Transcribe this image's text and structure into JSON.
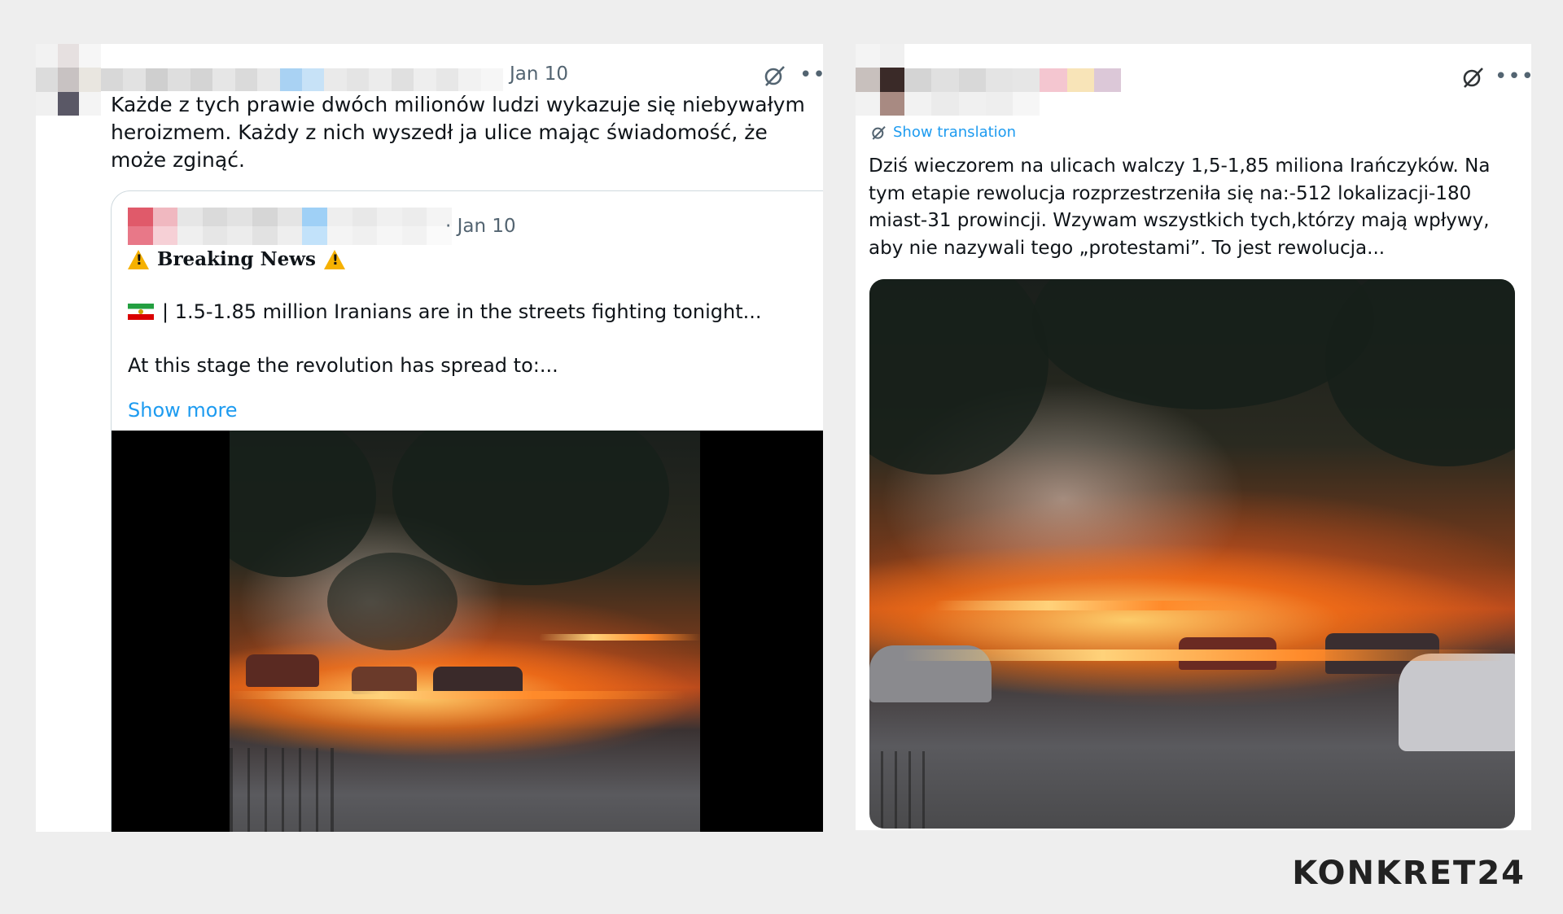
{
  "posts": [
    {
      "date": "Jan 10",
      "text": "Każde z tych prawie dwóch milionów ludzi wykazuje się niebywałym heroizmem. Każdy z nich wyszedł ja ulice mając świadomość, że może zginąć.",
      "quote": {
        "date": "· Jan 10",
        "headline": "Breaking News",
        "line1": "| 1.5-1.85 million Iranians are in the streets fighting tonight...",
        "line2": "At this stage the revolution has spread to:...",
        "show_more": "Show more"
      }
    },
    {
      "show_translation": "Show translation",
      "text": "Dziś wieczorem na ulicach walczy 1,5-1,85 miliona Irańczyków. Na tym etapie rewolucja rozprzestrzeniła się na:-512 lokalizacji-180 miast-31 prowincji. Wzywam wszystkich tych,którzy mają wpływy, aby nie nazywali tego „protestami”. To jest rewolucja..."
    }
  ],
  "brand": "KONKRET24",
  "icons": [
    "grok-icon",
    "more-options-icon",
    "warning-icon",
    "iran-flag-icon"
  ],
  "colors": {
    "link": "#1d9bf0",
    "text": "#0f1419",
    "muted": "#536471",
    "background": "#eeeeee"
  }
}
